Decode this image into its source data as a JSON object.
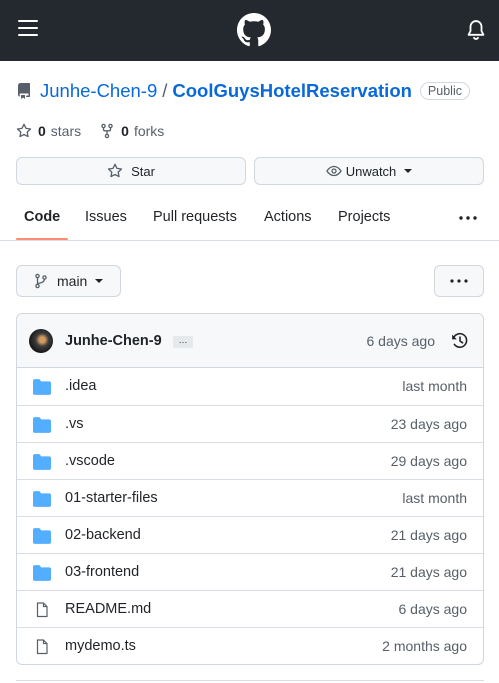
{
  "topbar": {
    "menu_icon": "hamburger-icon",
    "logo_icon": "github-logo",
    "notification_icon": "bell-icon"
  },
  "repo": {
    "owner": "Junhe-Chen-9",
    "separator": "/",
    "name": "CoolGuysHotelReservation",
    "visibility": "Public",
    "icon": "repo-icon"
  },
  "stats": {
    "stars_count": "0",
    "stars_label": "stars",
    "forks_count": "0",
    "forks_label": "forks"
  },
  "actions": {
    "star_label": "Star",
    "watch_label": "Unwatch"
  },
  "tabs": [
    {
      "label": "Code",
      "active": true
    },
    {
      "label": "Issues"
    },
    {
      "label": "Pull requests"
    },
    {
      "label": "Actions"
    },
    {
      "label": "Projects"
    }
  ],
  "branch": {
    "name": "main"
  },
  "commit": {
    "author": "Junhe-Chen-9",
    "ellipsis": "…",
    "time": "6 days ago"
  },
  "files": [
    {
      "name": ".idea",
      "type": "folder",
      "time": "last month"
    },
    {
      "name": ".vs",
      "type": "folder",
      "time": "23 days ago"
    },
    {
      "name": ".vscode",
      "type": "folder",
      "time": "29 days ago"
    },
    {
      "name": "01-starter-files",
      "type": "folder",
      "time": "last month"
    },
    {
      "name": "02-backend",
      "type": "folder",
      "time": "21 days ago"
    },
    {
      "name": "03-frontend",
      "type": "folder",
      "time": "21 days ago"
    },
    {
      "name": "README.md",
      "type": "file",
      "time": "6 days ago"
    },
    {
      "name": "mydemo.ts",
      "type": "file",
      "time": "2 months ago"
    }
  ],
  "colors": {
    "topbar_bg": "#24292f",
    "link": "#0969da",
    "folder": "#54aeff",
    "tab_underline": "#fd8c73"
  }
}
